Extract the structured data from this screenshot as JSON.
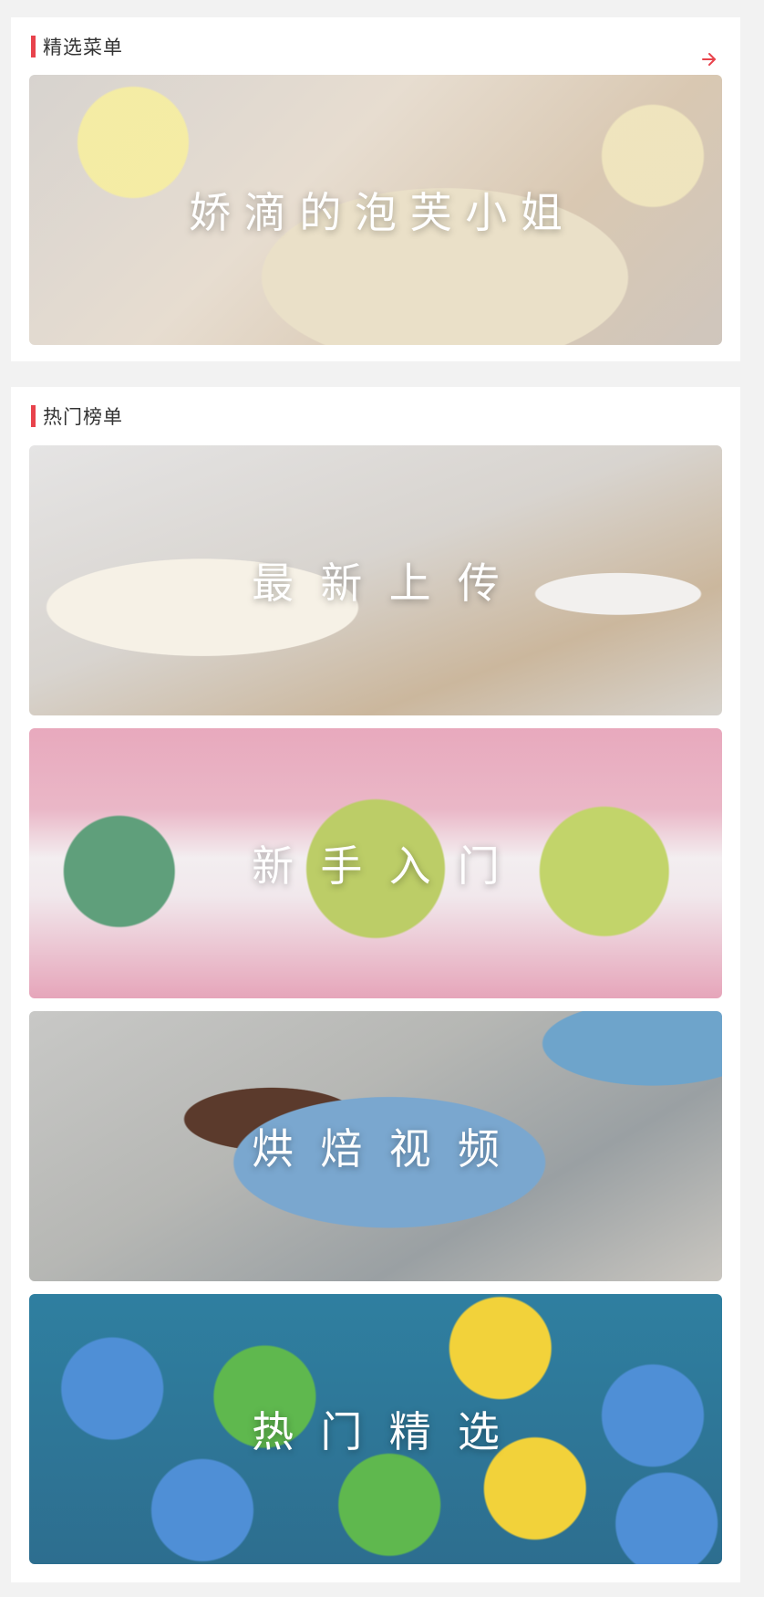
{
  "featured": {
    "title": "精选菜单",
    "more_icon": "arrow-right-icon",
    "banner": {
      "caption": "娇 滴 的 泡 芙 小 姐"
    }
  },
  "hot": {
    "title": "热门榜单",
    "banners": [
      {
        "caption": "最  新  上  传"
      },
      {
        "caption": "新  手  入  门"
      },
      {
        "caption": "烘  焙  视  频"
      },
      {
        "caption": "热  门  精  选"
      }
    ]
  },
  "colors": {
    "accent": "#e8434c",
    "background": "#f2f2f2",
    "card": "#ffffff",
    "title_text": "#333333",
    "caption_text": "#ffffff"
  }
}
